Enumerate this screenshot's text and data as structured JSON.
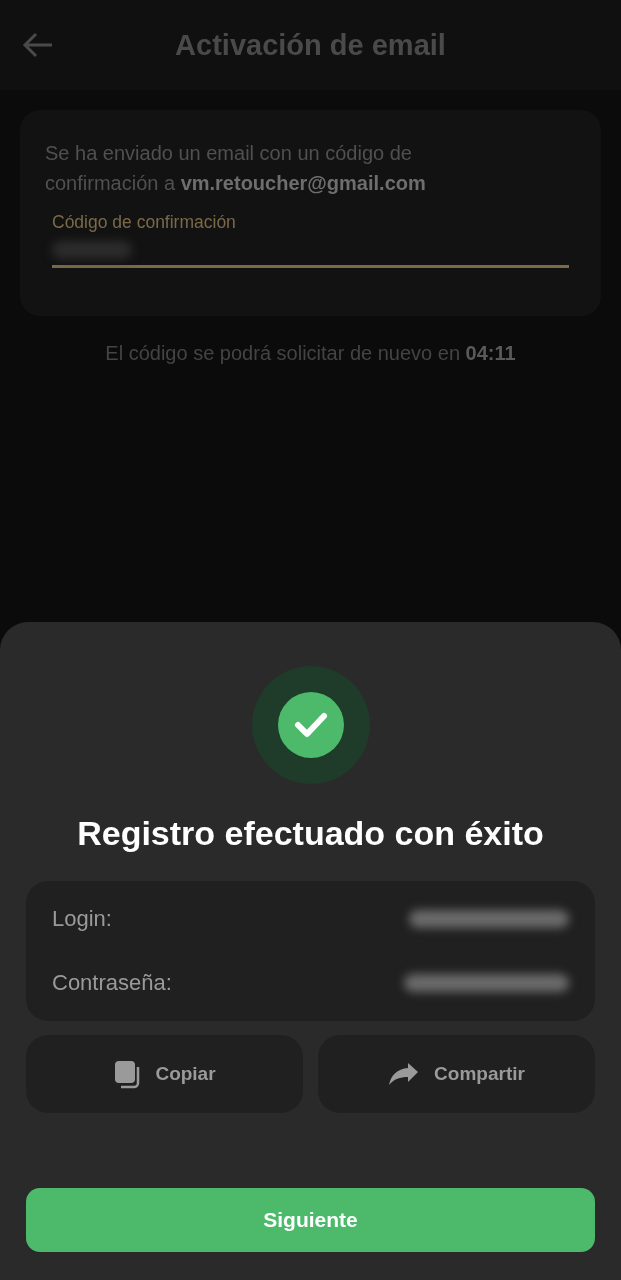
{
  "header": {
    "title": "Activación de email"
  },
  "notice": "Se ha enviado un email con un código de confirmación a **vm.retoucher@gmail.com**",
  "code_field": {
    "label": "Código de confirmación"
  },
  "resend_timer": "El código se podrá solicitar de nuevo en **04:11**",
  "dialog": {
    "title": "Registro efectuado con éxito",
    "credentials": [
      {
        "label": "Login:"
      },
      {
        "label": "Contraseña:"
      }
    ],
    "actions": [
      {
        "label": "Copiar",
        "kind": "copy"
      },
      {
        "label": "Compartir",
        "kind": "share"
      }
    ],
    "primary_button": "Siguiente"
  }
}
